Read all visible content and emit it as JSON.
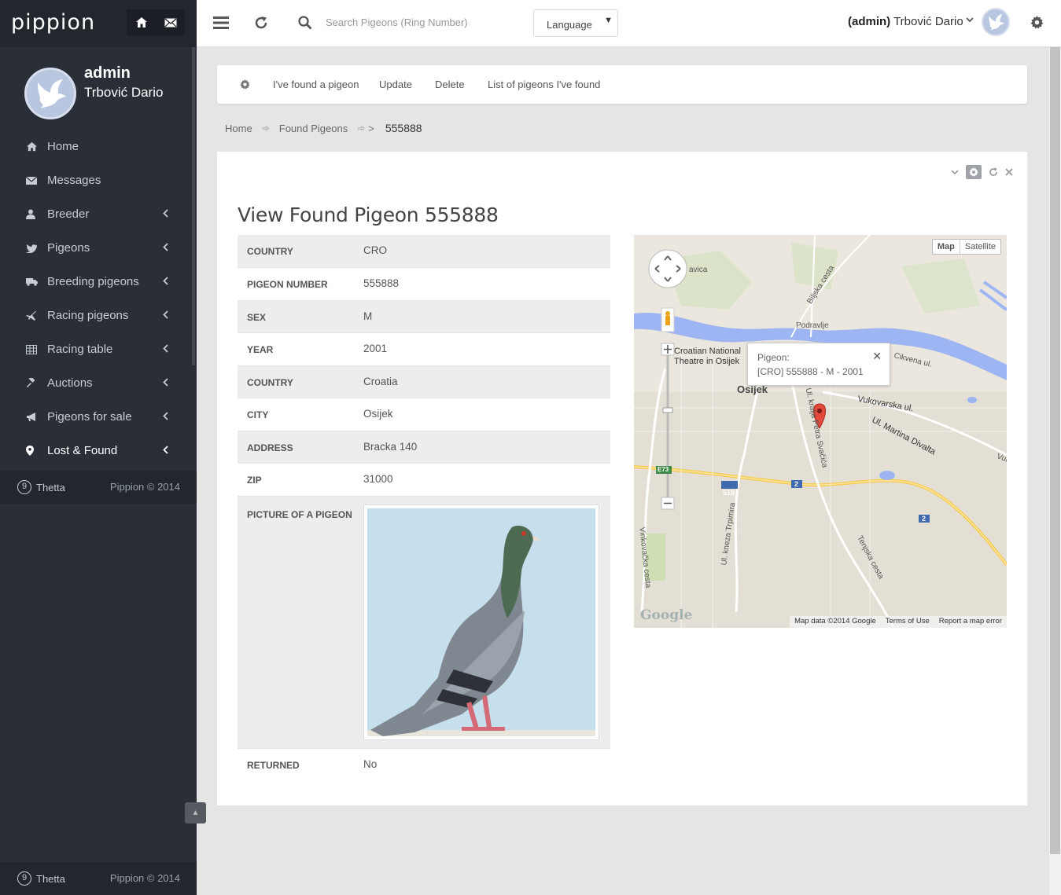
{
  "app": {
    "logo": "pippion"
  },
  "profile": {
    "role": "admin",
    "name": "Trbović Dario"
  },
  "nav": [
    {
      "label": "Home",
      "icon": "home-icon",
      "chevron": false
    },
    {
      "label": "Messages",
      "icon": "envelope-icon",
      "chevron": false
    },
    {
      "label": "Breeder",
      "icon": "user-icon",
      "chevron": true
    },
    {
      "label": "Pigeons",
      "icon": "bird-icon",
      "chevron": true
    },
    {
      "label": "Breeding pigeons",
      "icon": "truck-icon",
      "chevron": true
    },
    {
      "label": "Racing pigeons",
      "icon": "plane-icon",
      "chevron": true
    },
    {
      "label": "Racing table",
      "icon": "table-icon",
      "chevron": true
    },
    {
      "label": "Auctions",
      "icon": "gavel-icon",
      "chevron": true
    },
    {
      "label": "Pigeons for sale",
      "icon": "bullhorn-icon",
      "chevron": true
    },
    {
      "label": "Lost & Found",
      "icon": "map-marker-icon",
      "chevron": true
    }
  ],
  "footer": {
    "company": "Thetta",
    "copyright": "Pippion © 2014"
  },
  "topbar": {
    "search_placeholder": "Search Pigeons (Ring Number)",
    "language": "Language",
    "user_role": "(admin)",
    "user_name": " Trbović Dario"
  },
  "actions": [
    "I've found a pigeon",
    "Update",
    "Delete",
    "List of pigeons I've found"
  ],
  "breadcrumb": {
    "home": "Home",
    "section": "Found Pigeons",
    "current": "555888"
  },
  "panel": {
    "title": "View Found Pigeon 555888"
  },
  "details": [
    {
      "label": "Country",
      "value": "CRO"
    },
    {
      "label": "Pigeon Number",
      "value": "555888"
    },
    {
      "label": "Sex",
      "value": "M"
    },
    {
      "label": "Year",
      "value": "2001"
    },
    {
      "label": "Country",
      "value": "Croatia"
    },
    {
      "label": "City",
      "value": "Osijek"
    },
    {
      "label": "Address",
      "value": "Bracka 140"
    },
    {
      "label": "Zip",
      "value": "31000"
    },
    {
      "label": "Picture of a pigeon",
      "value": ""
    },
    {
      "label": "Returned",
      "value": "No"
    }
  ],
  "map": {
    "type_map": "Map",
    "type_satellite": "Satellite",
    "info_title": "Pigeon:",
    "info_text": "[CRO] 555888 - M - 2001",
    "attribution": "Map data ©2014 Google",
    "terms": "Terms of Use",
    "report": "Report a map error",
    "logo": "Google",
    "labels": {
      "city": "Osijek",
      "theatre1": "Croatian National",
      "theatre2": "Theatre in Osijek",
      "podravlje": "Podravlje",
      "bilj": "Biljska cesta",
      "vukovarska": "Vukovarska ul.",
      "martina": "Ul. Martina Divalta",
      "kralja": "Ul. kralja Petra Svačića",
      "kneza": "Ul. kneza Trpimira",
      "vinkovacka": "Vinkovačka cesta",
      "tenjska": "Tenjska cesta",
      "cirkvena": "Cikvena ul.",
      "avica": "avica",
      "vuko": "Vuko",
      "r518": "518",
      "r2a": "2",
      "r2b": "2",
      "e73": "E73"
    }
  }
}
